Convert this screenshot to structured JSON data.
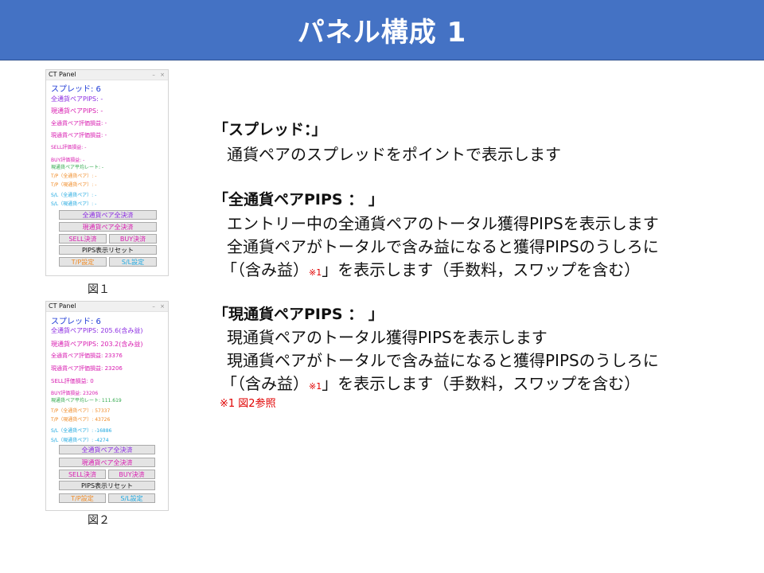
{
  "slide": {
    "title": "パネル構成 1"
  },
  "panel1": {
    "window_title": "CT Panel",
    "window_controls": "– ×",
    "spread": "スプレッド: 6",
    "all_pips": "全通貨ペアPIPS:  -",
    "cur_pips": "現通貨ペアPIPS:  -",
    "all_eval": "全通貨ペア評価損益:  -",
    "cur_eval": "現通貨ペア評価損益:  -",
    "sell_eval": "SELL評価損益:  -",
    "buy_eval": "BUY評価損益:  -",
    "avg_rate": "現通貨ペア平均レート:  -",
    "tp_all": "T/P（全通貨ペア）:  -",
    "tp_cur": "T/P（現通貨ペア）:  -",
    "sl_all": "S/L（全通貨ペア）:  -",
    "sl_cur": "S/L（現通貨ペア）:  -",
    "btn_all_close": "全通貨ペア全決済",
    "btn_cur_close": "現通貨ペア全決済",
    "btn_sell": "SELL決済",
    "btn_buy": "BUY決済",
    "btn_reset": "PIPS表示リセット",
    "btn_tp": "T/P設定",
    "btn_sl": "S/L設定",
    "caption": "図１"
  },
  "panel2": {
    "window_title": "CT Panel",
    "window_controls": "– ×",
    "spread": "スプレッド: 6",
    "all_pips": "全通貨ペアPIPS: 205.6(含み益)",
    "cur_pips": "現通貨ペアPIPS: 203.2(含み益)",
    "all_eval": "全通貨ペア評価損益: 23376",
    "cur_eval": "現通貨ペア評価損益: 23206",
    "sell_eval": "SELL評価損益: 0",
    "buy_eval": "BUY評価損益: 23206",
    "avg_rate": "現通貨ペア平均レート: 111.619",
    "tp_all": "T/P（全通貨ペア）: 57337",
    "tp_cur": "T/P（現通貨ペア）: 43726",
    "sl_all": "S/L（全通貨ペア）: -16886",
    "sl_cur": "S/L（現通貨ペア）: -4274",
    "btn_all_close": "全通貨ペア全決済",
    "btn_cur_close": "現通貨ペア全決済",
    "btn_sell": "SELL決済",
    "btn_buy": "BUY決済",
    "btn_reset": "PIPS表示リセット",
    "btn_tp": "T/P設定",
    "btn_sl": "S/L設定",
    "caption": "図２"
  },
  "content": {
    "h1": "「スプレッド：」",
    "l1": "通貨ペアのスプレッドをポイントで表示します",
    "h2": "「全通貨ペアPIPS ： 」",
    "l2a": "エントリー中の全通貨ペアのトータル獲得PIPSを表示します",
    "l2b": "全通貨ペアがトータルで含み益になると獲得PIPSのうしろに",
    "l2c_pre": "「（含み益）",
    "l2c_mark": "※1",
    "l2c_post": "」を表示します（手数料，スワップを含む）",
    "h3": "「現通貨ペアPIPS ： 」",
    "l3a": "現通貨ペアのトータル獲得PIPSを表示します",
    "l3b": "現通貨ペアがトータルで含み益になると獲得PIPSのうしろに",
    "l3c_pre": "「（含み益）",
    "l3c_mark": "※1",
    "l3c_post": "」を表示します（手数料，スワップを含む）",
    "note": "※1  図2参照"
  },
  "colors": {
    "header": "#4472C4",
    "spread": "#1F3BD6",
    "pips_all": "#8B2BE2",
    "pips_cur": "#D81BB0",
    "eval": "#D81BB0",
    "avg": "#2EA84A",
    "tp": "#F08A24",
    "sl": "#1EA8E0",
    "note": "#E00000"
  }
}
